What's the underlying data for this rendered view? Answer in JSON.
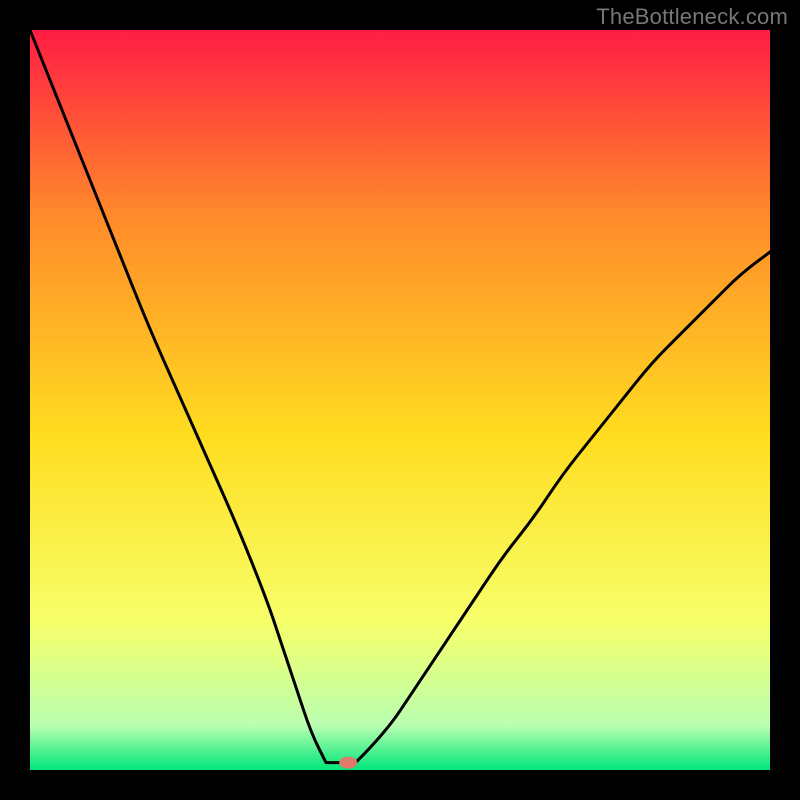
{
  "watermark": "TheBottleneck.com",
  "chart_data": {
    "type": "line",
    "title": "",
    "xlabel": "",
    "ylabel": "",
    "xlim": [
      0,
      100
    ],
    "ylim": [
      0,
      100
    ],
    "grid": false,
    "legend": false,
    "background_gradient": {
      "top": "#ff1c44",
      "upper_mid": "#ff8a2b",
      "mid": "#ffdd20",
      "lower_mid": "#f7ff6a",
      "near_bottom": "#b9ffb0",
      "bottom": "#00e67a"
    },
    "series": [
      {
        "name": "bottleneck-curve",
        "color": "#000000",
        "x": [
          0,
          4,
          8,
          12,
          16,
          20,
          24,
          28,
          32,
          34,
          36,
          38,
          40,
          42,
          44,
          48,
          52,
          56,
          60,
          64,
          68,
          72,
          76,
          80,
          84,
          88,
          92,
          96,
          100
        ],
        "y": [
          100,
          90,
          80,
          70,
          60,
          51,
          42,
          33,
          23,
          17,
          11,
          5,
          2,
          1,
          1,
          5,
          11,
          17,
          23,
          29,
          34,
          40,
          45,
          50,
          55,
          59,
          63,
          67,
          70
        ]
      }
    ],
    "marker": {
      "name": "optimal-point",
      "x": 43,
      "y": 1,
      "color": "#e07a6a",
      "shape": "ellipse"
    },
    "flat_bottom": {
      "x_start": 40,
      "x_end": 44,
      "y": 1
    }
  }
}
